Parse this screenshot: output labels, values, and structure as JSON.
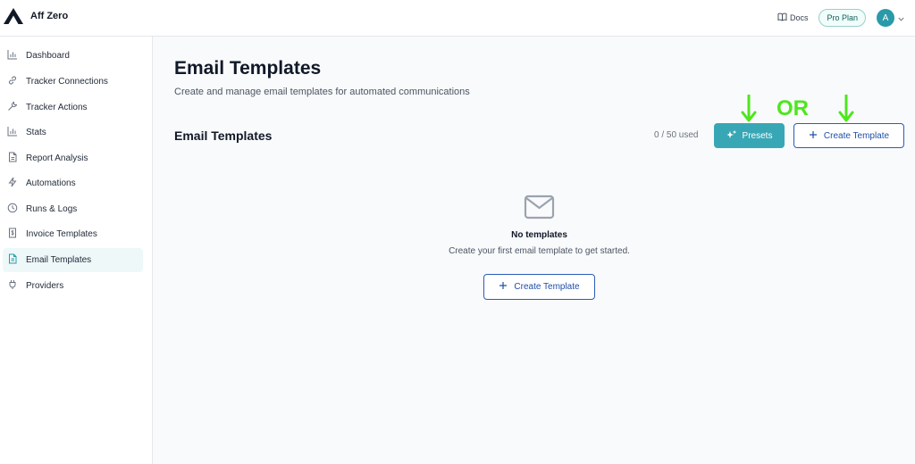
{
  "header": {
    "brand": "Aff Zero",
    "logo_icon": "brand-logo-triangle",
    "docs_label": "Docs",
    "docs_icon": "book-open-icon",
    "plan_badge": "Pro Plan",
    "avatar_initial": "A",
    "colors": {
      "avatar": "#2a9aa8"
    }
  },
  "sidebar": {
    "items": [
      {
        "label": "Dashboard",
        "icon": "bar-chart-icon",
        "active": false
      },
      {
        "label": "Tracker Connections",
        "icon": "link-icon",
        "active": false
      },
      {
        "label": "Tracker Actions",
        "icon": "wrench-icon",
        "active": false
      },
      {
        "label": "Stats",
        "icon": "bar-chart-icon",
        "active": false
      },
      {
        "label": "Report Analysis",
        "icon": "document-icon",
        "active": false
      },
      {
        "label": "Automations",
        "icon": "lightning-icon",
        "active": false
      },
      {
        "label": "Runs & Logs",
        "icon": "clock-icon",
        "active": false
      },
      {
        "label": "Invoice Templates",
        "icon": "dollar-document-icon",
        "active": false
      },
      {
        "label": "Email Templates",
        "icon": "document-text-icon",
        "active": true
      },
      {
        "label": "Providers",
        "icon": "plug-icon",
        "active": false
      }
    ]
  },
  "main": {
    "title": "Email Templates",
    "subtitle": "Create and manage email templates for automated communications",
    "section_title": "Email Templates",
    "usage": "0 / 50 used",
    "presets_label": "Presets",
    "create_label": "Create Template",
    "annotation_or": "OR",
    "empty": {
      "icon": "envelope-icon",
      "title": "No templates",
      "description": "Create your first email template to get started.",
      "button_label": "Create Template"
    },
    "colors": {
      "accent": "#38a7b5",
      "link_blue": "#1e4fa8",
      "annotation_green": "#4ee61e"
    }
  }
}
